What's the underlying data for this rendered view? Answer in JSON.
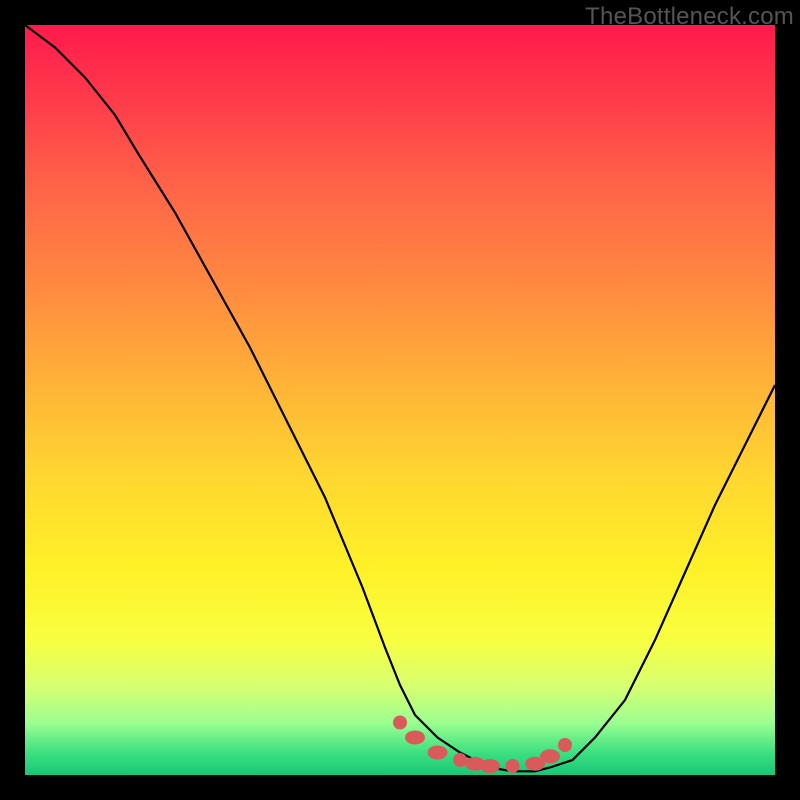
{
  "watermark": "TheBottleneck.com",
  "colors": {
    "background": "#000000",
    "curve_stroke": "#000000",
    "marker_fill": "#d85a5a",
    "gradient_top": "#ff1a4d",
    "gradient_bottom": "#18c778"
  },
  "chart_data": {
    "type": "line",
    "title": "",
    "xlabel": "",
    "ylabel": "",
    "xlim": [
      0,
      100
    ],
    "ylim": [
      0,
      100
    ],
    "curve": {
      "x": [
        0,
        4,
        8,
        12,
        15,
        20,
        25,
        30,
        35,
        40,
        45,
        48,
        50,
        52,
        55,
        58,
        60,
        62,
        65,
        68,
        70,
        73,
        76,
        80,
        84,
        88,
        92,
        96,
        100
      ],
      "y": [
        100,
        97,
        93,
        88,
        83,
        75,
        66,
        57,
        47,
        37,
        25,
        17,
        12,
        8,
        5,
        3,
        2,
        1,
        0.5,
        0.5,
        1,
        2,
        5,
        10,
        18,
        27,
        36,
        44,
        52
      ]
    },
    "flat_region_markers": {
      "x": [
        50,
        52,
        55,
        58,
        60,
        62,
        65,
        68,
        70,
        72
      ],
      "y": [
        7,
        5,
        3,
        2,
        1.5,
        1.2,
        1.2,
        1.5,
        2.5,
        4
      ]
    }
  }
}
